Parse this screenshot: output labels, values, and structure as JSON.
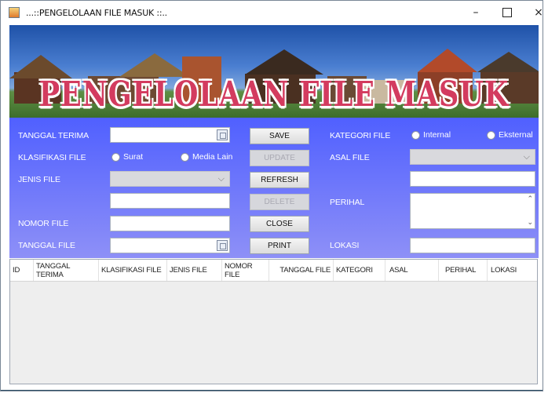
{
  "window": {
    "title": "...::PENGELOLAAN FILE MASUK ::..",
    "minimize": "–",
    "close": "×"
  },
  "banner": {
    "title": "PENGELOLAAN FILE MASUK"
  },
  "form": {
    "labels": {
      "tanggal_terima": "TANGGAL TERIMA",
      "klasifikasi_file": "KLASIFIKASI FILE",
      "jenis_file": "JENIS FILE",
      "nomor_file": "NOMOR FILE",
      "tanggal_file": "TANGGAL FILE",
      "kategori_file": "KATEGORI FILE",
      "asal_file": "ASAL FILE",
      "perihal": "PERIHAL",
      "lokasi": "LOKASI"
    },
    "radios": {
      "surat": "Surat",
      "media_lain": "Media Lain",
      "internal": "Internal",
      "eksternal": "Eksternal"
    },
    "buttons": {
      "save": "SAVE",
      "update": "UPDATE",
      "refresh": "REFRESH",
      "delete": "DELETE",
      "close": "CLOSE",
      "print": "PRINT"
    }
  },
  "table": {
    "columns": [
      "ID",
      "TANGGAL TERIMA",
      "KLASIFIKASI FILE",
      "JENIS FILE",
      "NOMOR FILE",
      "TANGGAL FILE",
      "KATEGORI",
      "ASAL",
      "PERIHAL",
      "LOKASI"
    ],
    "rows": []
  },
  "icons": {
    "calendar": "calendar-icon",
    "dropdown": "chevron-down-icon",
    "app": "java-app-icon"
  }
}
